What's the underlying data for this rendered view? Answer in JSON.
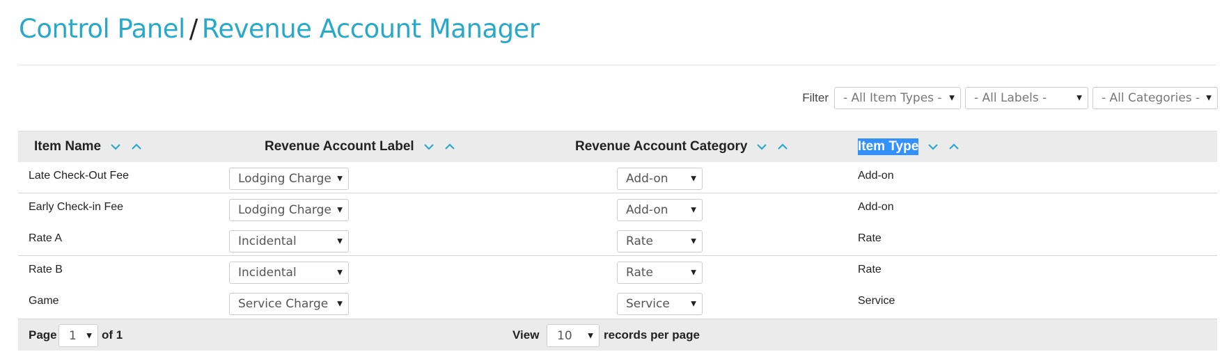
{
  "breadcrumb": {
    "root": "Control Panel",
    "separator": "/",
    "current": "Revenue Account Manager"
  },
  "filter": {
    "label": "Filter",
    "item_types": "- All Item Types -",
    "labels": "- All Labels -",
    "categories": "- All Categories -"
  },
  "table": {
    "headers": {
      "item_name": "Item Name",
      "label": "Revenue Account Label",
      "category": "Revenue Account Category",
      "item_type": "Item Type"
    },
    "rows": [
      {
        "name": "Late Check-Out Fee",
        "label": "Lodging Charge",
        "category": "Add-on",
        "type": "Add-on"
      },
      {
        "name": "Early Check-in Fee",
        "label": "Lodging Charge",
        "category": "Add-on",
        "type": "Add-on"
      },
      {
        "name": "Rate A",
        "label": "Incidental",
        "category": "Rate",
        "type": "Rate"
      },
      {
        "name": "Rate B",
        "label": "Incidental",
        "category": "Rate",
        "type": "Rate"
      },
      {
        "name": "Game",
        "label": "Service Charge",
        "category": "Service",
        "type": "Service"
      }
    ]
  },
  "pagination": {
    "page_label": "Page",
    "page_value": "1",
    "of_label": "of 1",
    "view_label": "View",
    "per_page_value": "10",
    "per_page_suffix": "records per page"
  },
  "colors": {
    "accent": "#29a9c9",
    "header_bg": "#ebebeb",
    "selection": "#3390ff"
  }
}
